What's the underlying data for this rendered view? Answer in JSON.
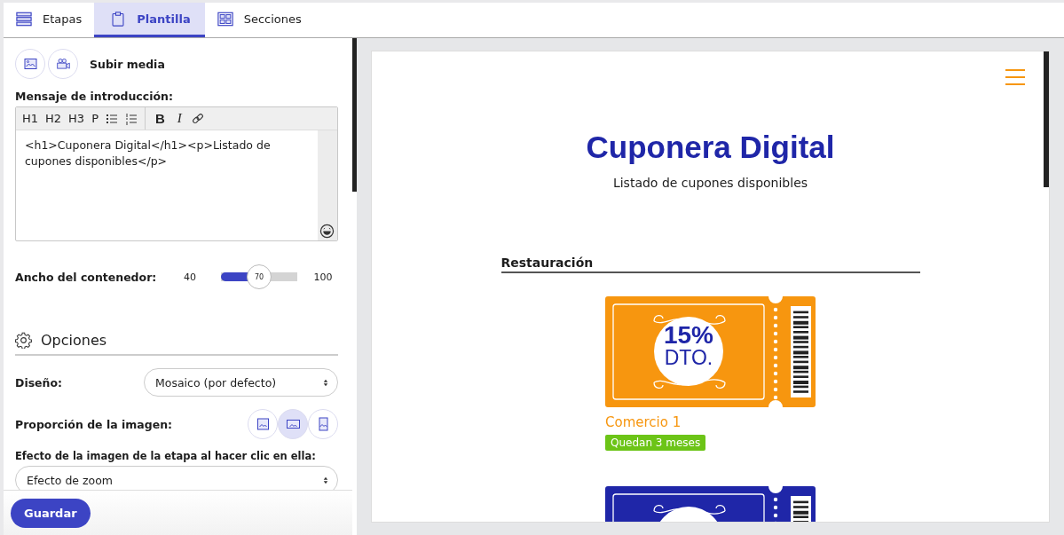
{
  "tabs": [
    {
      "label": "Etapas",
      "selected": false
    },
    {
      "label": "Plantilla",
      "selected": true
    },
    {
      "label": "Secciones",
      "selected": false
    }
  ],
  "media": {
    "label": "Subir media"
  },
  "intro": {
    "label": "Mensaje de introducción:",
    "toolbar": [
      "H1",
      "H2",
      "H3",
      "P"
    ],
    "format": [
      "B",
      "I"
    ],
    "value": "<h1>Cuponera Digital</h1><p>Listado de cupones disponibles</p>"
  },
  "width_slider": {
    "label": "Ancho del contenedor:",
    "min": "40",
    "max": "100",
    "reading": "70",
    "level": 0.5
  },
  "options": {
    "title": "Opciones",
    "design": {
      "label": "Diseño:",
      "value": "Mosaico (por defecto)"
    },
    "ratio": {
      "label": "Proporción de la imagen:",
      "choices": [
        {
          "selected": false
        },
        {
          "selected": true
        },
        {
          "selected": false
        }
      ]
    },
    "effect": {
      "label": "Efecto de la imagen de la etapa al hacer clic en ella:",
      "value": "Efecto de zoom"
    }
  },
  "save_button": "Guardar",
  "preview": {
    "title": "Cuponera Digital",
    "subtitle": "Listado de cupones disponibles",
    "category": "Restauración",
    "coupons": [
      {
        "color": "#f7960f",
        "discount": "15%",
        "unit": "DTO.",
        "name": "Comercio 1",
        "badge": "Quedan 3 meses"
      },
      {
        "color": "#1f26a8"
      }
    ]
  }
}
